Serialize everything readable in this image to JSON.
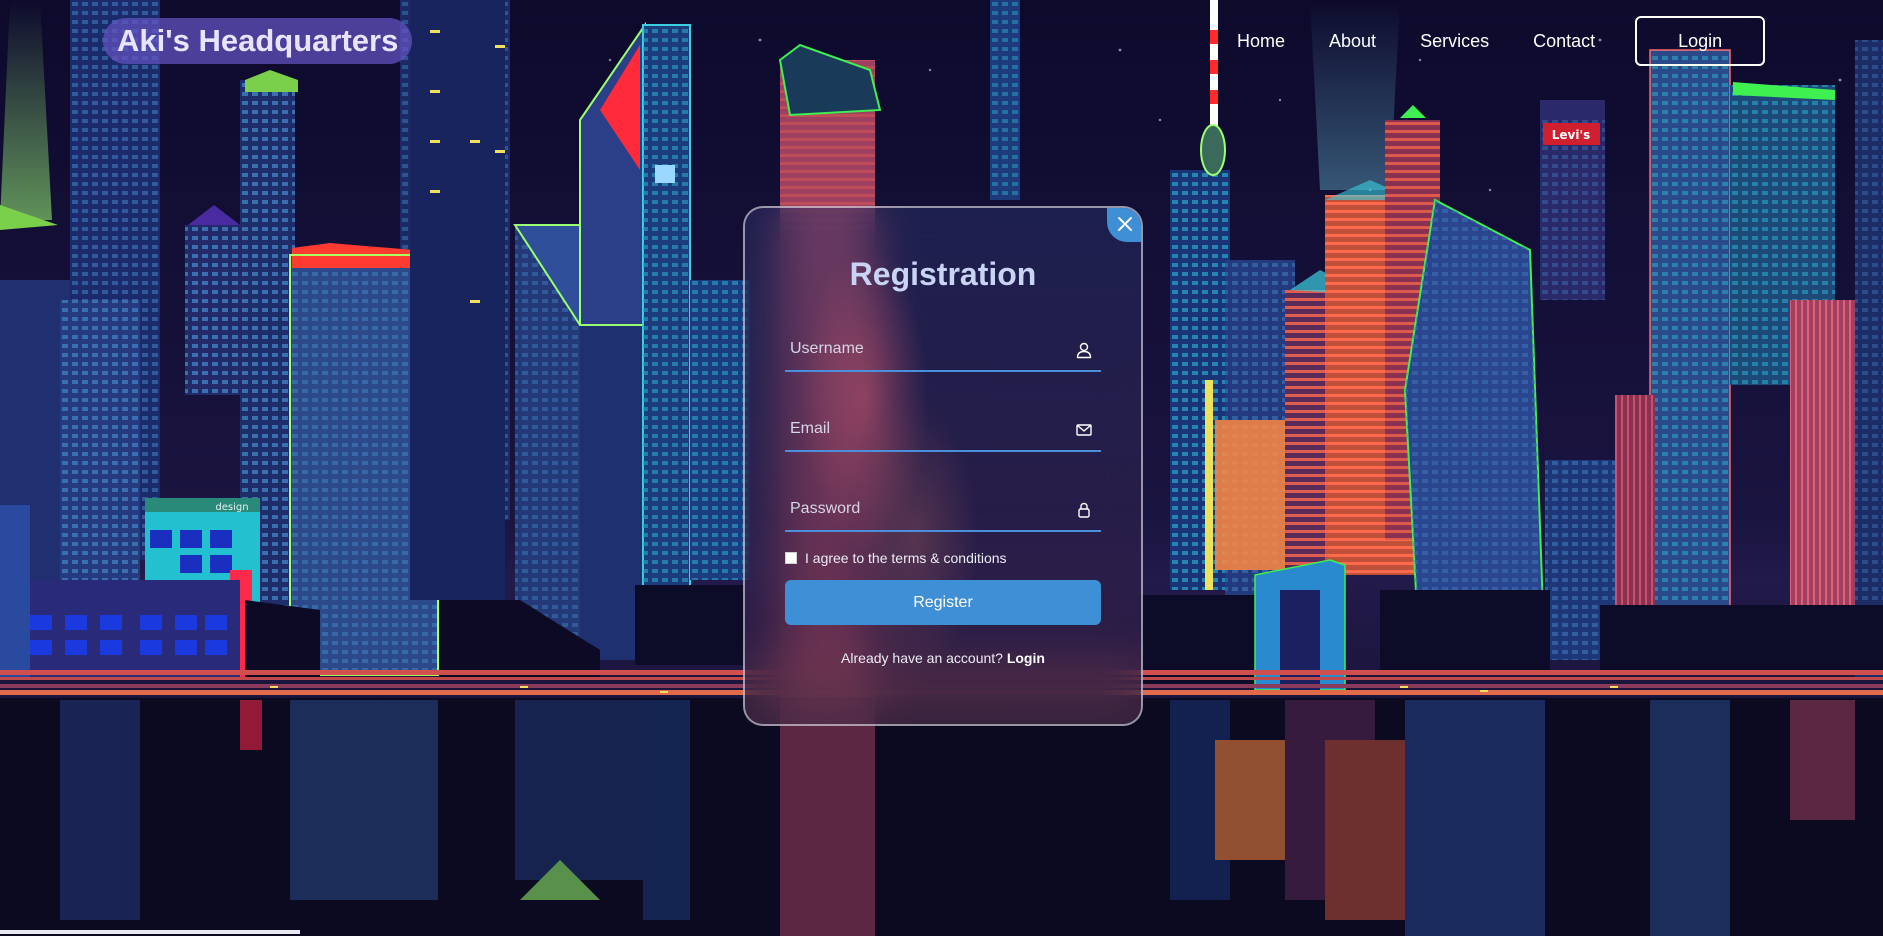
{
  "header": {
    "logo_text": "Aki's Headquarters",
    "nav": [
      {
        "label": "Home"
      },
      {
        "label": "About"
      },
      {
        "label": "Services"
      },
      {
        "label": "Contact"
      }
    ],
    "login_button": "Login"
  },
  "registration": {
    "title": "Registration",
    "fields": {
      "username": {
        "placeholder": "Username",
        "value": "",
        "icon": "user-icon"
      },
      "email": {
        "placeholder": "Email",
        "value": "",
        "icon": "mail-icon"
      },
      "password": {
        "placeholder": "Password",
        "value": "",
        "icon": "lock-icon"
      }
    },
    "terms_label": "I agree to the terms & conditions",
    "terms_checked": false,
    "register_button": "Register",
    "already_text": "Already have an account?",
    "login_link": "Login",
    "close_icon": "close-icon"
  },
  "background": {
    "billboard_text": "Levi's",
    "sign_text": "design"
  },
  "colors": {
    "accent": "#3e8fd6",
    "logo_bg": "#6252be",
    "title": "#c9d4f5",
    "underline": "#4b8fdc"
  }
}
